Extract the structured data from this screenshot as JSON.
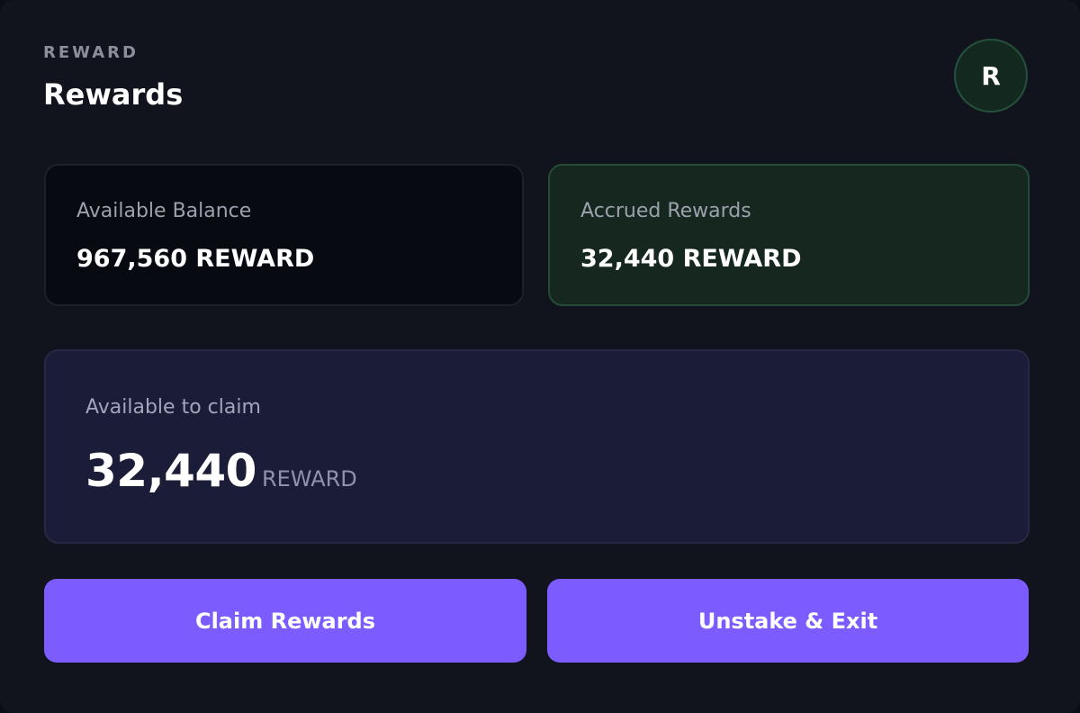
{
  "header": {
    "eyebrow": "REWARD",
    "title": "Rewards",
    "avatar_initial": "R"
  },
  "stats": {
    "balance": {
      "label": "Available Balance",
      "value": "967,560 REWARD"
    },
    "accrued": {
      "label": "Accrued Rewards",
      "value": "32,440 REWARD"
    }
  },
  "claim": {
    "label": "Available to claim",
    "amount": "32,440",
    "unit": "REWARD"
  },
  "actions": {
    "claim_label": "Claim Rewards",
    "exit_label": "Unstake & Exit"
  },
  "colors": {
    "background": "#11141c",
    "accent": "#7c5cff",
    "accrued_bg": "#15271f",
    "claim_panel_bg": "#1b1c38"
  }
}
